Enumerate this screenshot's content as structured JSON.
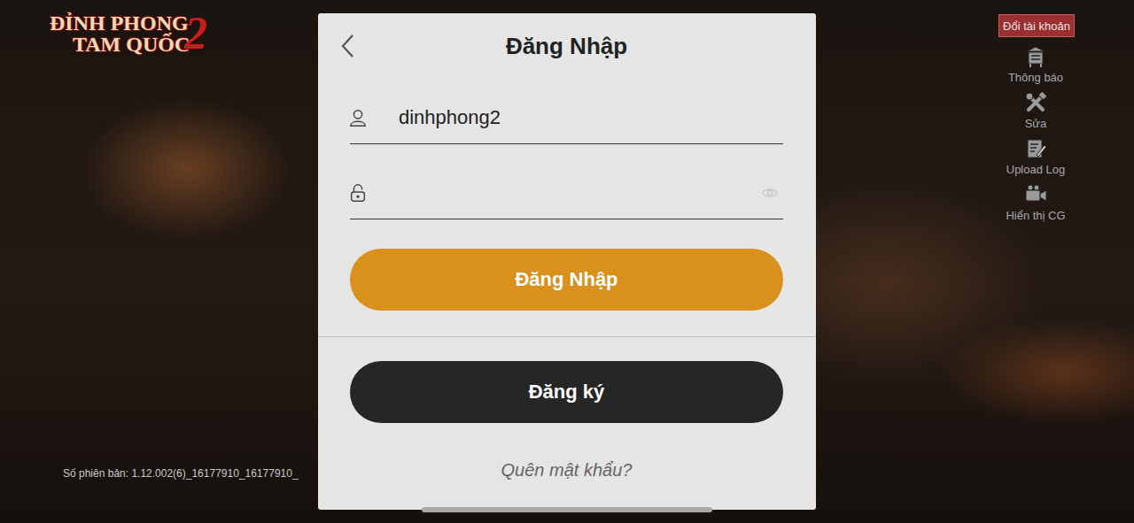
{
  "logo": {
    "line1": "ĐỈNH PHONG",
    "line2": "TAM QUỐC",
    "number": "2"
  },
  "version": "Số phiên bản: 1.12.002(6)_16177910_16177910_",
  "switch_account": "Đổi tài khoản",
  "side_menu": [
    {
      "label": "Thông báo"
    },
    {
      "label": "Sửa"
    },
    {
      "label": "Upload Log"
    },
    {
      "label": "Hiển thị CG"
    }
  ],
  "dialog": {
    "title": "Đăng Nhập",
    "username": "dinhphong2",
    "password": "",
    "login_button": "Đăng Nhập",
    "register_button": "Đăng ký",
    "forgot_link": "Quên mật khẩu?"
  }
}
